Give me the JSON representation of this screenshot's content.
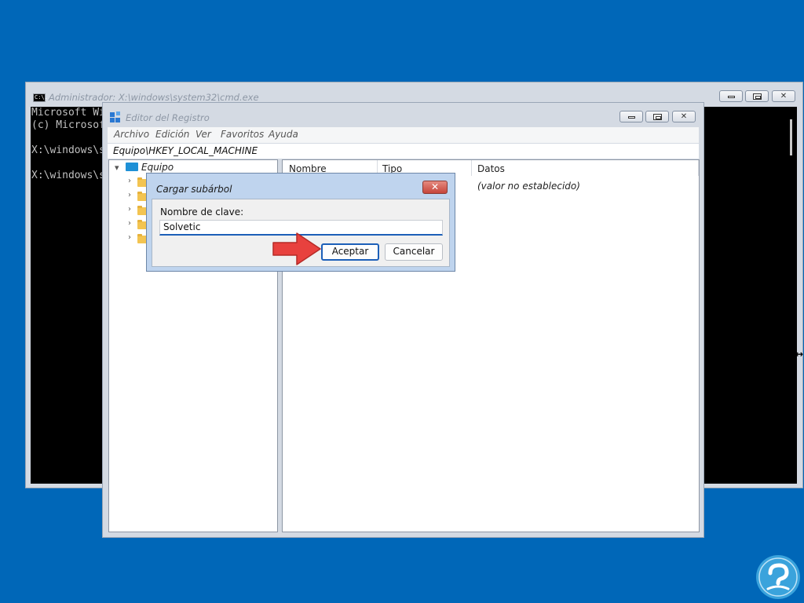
{
  "cmd_window": {
    "title": "Administrador: X:\\windows\\system32\\cmd.exe",
    "icon_text": "C:\\.",
    "console_lines": [
      "Microsoft Wi",
      "(c) Microsof",
      "",
      "X:\\windows\\s",
      "",
      "X:\\windows\\s"
    ],
    "buttons": [
      "minimize",
      "maximize",
      "close"
    ]
  },
  "regedit_window": {
    "title": "Editor del Registro",
    "menu": [
      "Archivo",
      "Edición",
      "Ver",
      "Favoritos",
      "Ayuda"
    ],
    "address": "Equipo\\HKEY_LOCAL_MACHINE",
    "tree": {
      "root": "Equipo",
      "children_count": 5
    },
    "list": {
      "columns": [
        "Nombre",
        "Tipo",
        "Datos"
      ],
      "rows": [
        {
          "name": "",
          "type": "",
          "data": "(valor no establecido)"
        }
      ]
    }
  },
  "dialog": {
    "title": "Cargar subárbol",
    "label": "Nombre de clave:",
    "input_value": "Solvetic",
    "ok_label": "Aceptar",
    "cancel_label": "Cancelar",
    "close_glyph": "✕"
  },
  "colors": {
    "desktop": "#0067b8",
    "arrow": "#e8413e",
    "logo": "#3aa3dc",
    "primary_border": "#1c5fb8"
  },
  "icons": {
    "logo": "solvetic-logo",
    "annotation": "arrow-pointer"
  }
}
